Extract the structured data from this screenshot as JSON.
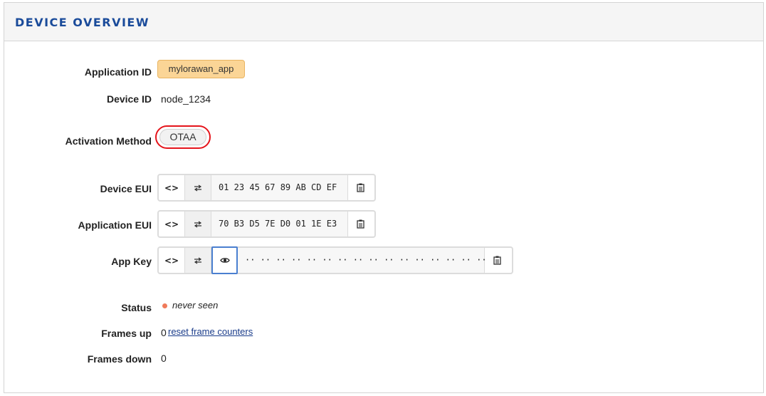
{
  "header": {
    "title": "DEVICE OVERVIEW"
  },
  "fields": {
    "application_id": {
      "label": "Application ID",
      "value": "mylorawan_app"
    },
    "device_id": {
      "label": "Device ID",
      "value": "node_1234"
    },
    "activation_method": {
      "label": "Activation Method",
      "value": "OTAA"
    },
    "device_eui": {
      "label": "Device EUI",
      "value": "01 23 45 67 89 AB CD EF"
    },
    "application_eui": {
      "label": "Application EUI",
      "value": "70 B3 D5 7E D0 01 1E E3"
    },
    "app_key": {
      "label": "App Key",
      "value": "·· ·· ·· ·· ·· ·· ·· ·· ·· ·· ·· ·· ·· ·· ·· ··"
    },
    "status": {
      "label": "Status",
      "value": "never seen",
      "dot_color": "#f07a5a"
    },
    "frames_up": {
      "label": "Frames up",
      "value": "0",
      "link": "reset frame counters"
    },
    "frames_down": {
      "label": "Frames down",
      "value": "0"
    }
  },
  "icons": {
    "format_toggle": "code-brackets-icon",
    "byte_order": "swap-arrows-icon",
    "reveal": "eye-icon",
    "copy": "clipboard-icon"
  },
  "colors": {
    "title": "#1a4b9a",
    "app_badge": "#fbd596",
    "highlight_circle": "#e5141b",
    "link": "#1a3c8a"
  }
}
